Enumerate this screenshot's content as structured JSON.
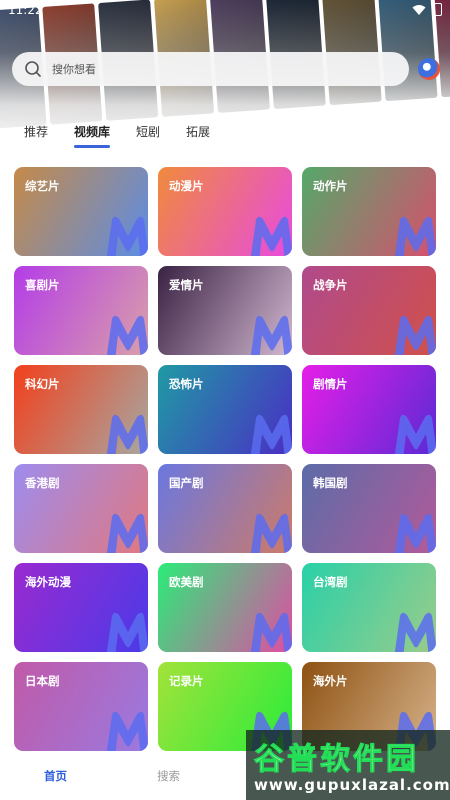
{
  "status_bar": {
    "time": "11:22"
  },
  "search": {
    "placeholder": "搜你想看"
  },
  "tabs": [
    {
      "label": "推荐",
      "active": false
    },
    {
      "label": "视频库",
      "active": true
    },
    {
      "label": "短剧",
      "active": false
    },
    {
      "label": "拓展",
      "active": false
    }
  ],
  "categories": [
    {
      "label": "综艺片",
      "gradient": [
        "#c58a48",
        "#5c8de6"
      ]
    },
    {
      "label": "动漫片",
      "gradient": [
        "#f08a3c",
        "#e84be0"
      ]
    },
    {
      "label": "动作片",
      "gradient": [
        "#55a86a",
        "#d6506e"
      ]
    },
    {
      "label": "喜剧片",
      "gradient": [
        "#b43ce8",
        "#d9a0a8"
      ]
    },
    {
      "label": "爱情片",
      "gradient": [
        "#3a2244",
        "#d2b8d0"
      ]
    },
    {
      "label": "战争片",
      "gradient": [
        "#b04a8c",
        "#d0504a"
      ]
    },
    {
      "label": "科幻片",
      "gradient": [
        "#f2401c",
        "#a6a8a2"
      ]
    },
    {
      "label": "恐怖片",
      "gradient": [
        "#1f9aa4",
        "#4a2ec4"
      ]
    },
    {
      "label": "剧情片",
      "gradient": [
        "#e61ee8",
        "#5a2ad4"
      ]
    },
    {
      "label": "香港剧",
      "gradient": [
        "#9e8cee",
        "#e07880"
      ]
    },
    {
      "label": "国产剧",
      "gradient": [
        "#6a78e0",
        "#ce7a68"
      ]
    },
    {
      "label": "韩国剧",
      "gradient": [
        "#5c6ca8",
        "#b25a9a"
      ]
    },
    {
      "label": "海外动漫",
      "gradient": [
        "#9a2ad0",
        "#4a3ae8"
      ]
    },
    {
      "label": "欧美剧",
      "gradient": [
        "#2aec78",
        "#e04ca4"
      ]
    },
    {
      "label": "台湾剧",
      "gradient": [
        "#2ad0a8",
        "#9acc8a"
      ]
    },
    {
      "label": "日本剧",
      "gradient": [
        "#c05aa8",
        "#9a7ae0"
      ]
    },
    {
      "label": "记录片",
      "gradient": [
        "#a2e23a",
        "#2aec3a"
      ]
    },
    {
      "label": "海外片",
      "gradient": [
        "#8e5212",
        "#d6b28a"
      ]
    }
  ],
  "bottom_nav": {
    "home": "首页",
    "search": "搜索"
  },
  "watermark": {
    "title": "谷普软件园",
    "url": "www.gupuxlazal.com"
  },
  "colors": {
    "accent": "#2f5fd8",
    "tab_indicator": "#3b63d8",
    "m_logo": "#5a6cf0"
  }
}
